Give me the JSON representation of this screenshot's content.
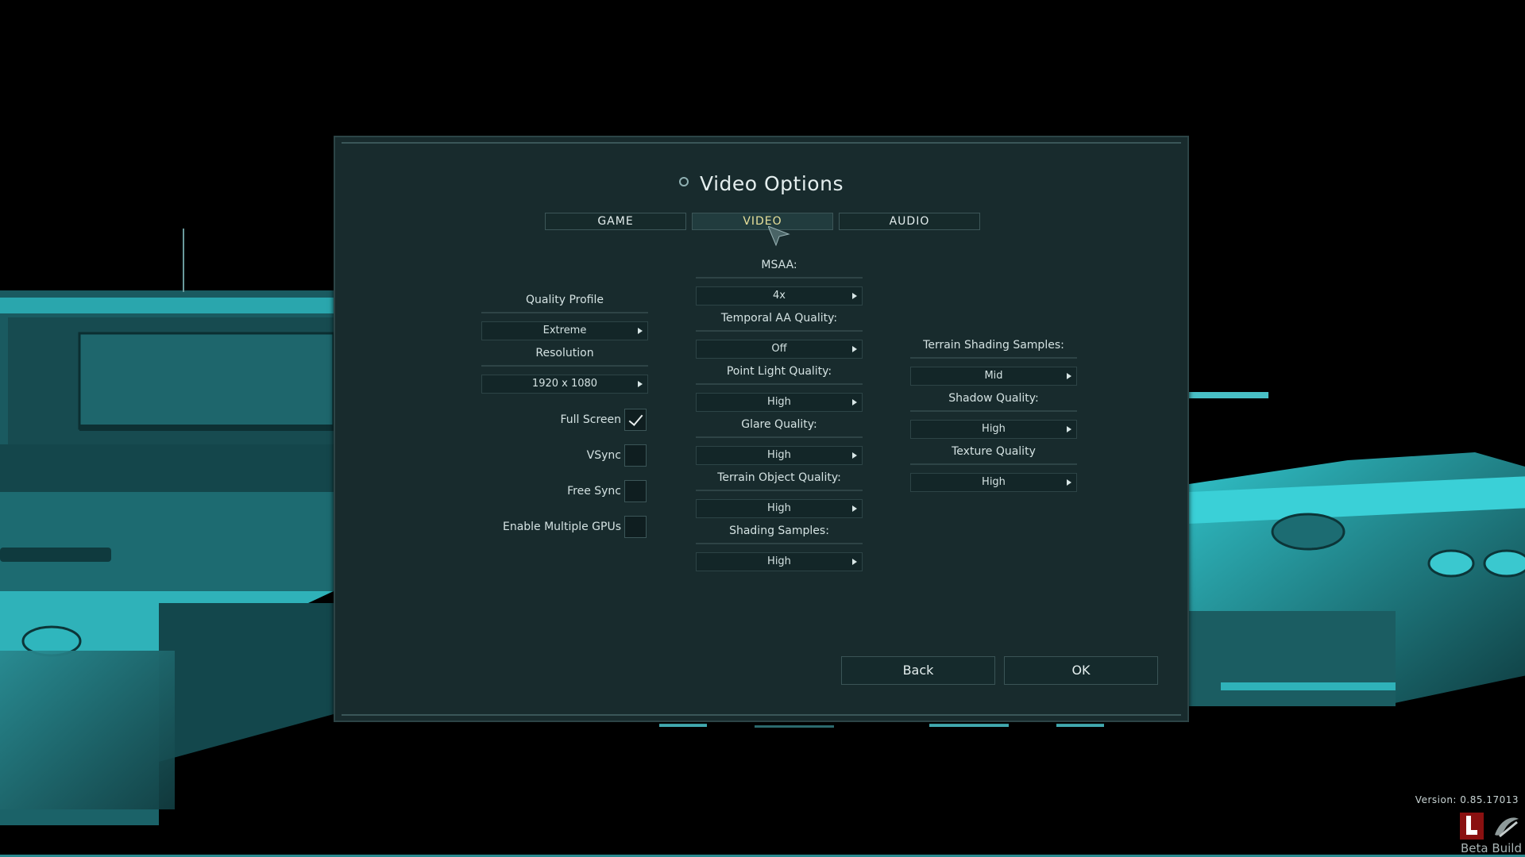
{
  "window": {
    "title": "Video Options"
  },
  "tabs": [
    {
      "label": "GAME",
      "active": false
    },
    {
      "label": "VIDEO",
      "active": true
    },
    {
      "label": "AUDIO",
      "active": false
    }
  ],
  "left": {
    "quality_profile": {
      "label": "Quality Profile",
      "value": "Extreme"
    },
    "resolution": {
      "label": "Resolution",
      "value": "1920 x 1080"
    },
    "checkboxes": [
      {
        "label": "Full Screen",
        "checked": true
      },
      {
        "label": "VSync",
        "checked": false
      },
      {
        "label": "Free Sync",
        "checked": false
      },
      {
        "label": "Enable Multiple GPUs",
        "checked": false
      }
    ]
  },
  "middle": [
    {
      "label": "MSAA:",
      "value": "4x"
    },
    {
      "label": "Temporal AA Quality:",
      "value": "Off"
    },
    {
      "label": "Point Light Quality:",
      "value": "High"
    },
    {
      "label": "Glare Quality:",
      "value": "High"
    },
    {
      "label": "Terrain Object Quality:",
      "value": "High"
    },
    {
      "label": "Shading Samples:",
      "value": "High"
    }
  ],
  "right": [
    {
      "label": "Terrain Shading Samples:",
      "value": "Mid"
    },
    {
      "label": "Shadow Quality:",
      "value": "High"
    },
    {
      "label": "Texture Quality",
      "value": "High"
    }
  ],
  "footer": {
    "back_label": "Back",
    "ok_label": "OK"
  },
  "corner": {
    "version": "Version: 0.85.17013",
    "build": "Beta Build"
  },
  "colors": {
    "accent": "#3fd6dc",
    "panel": "#1a2e30",
    "active_tab_text": "#e8e09a"
  },
  "icons": {
    "title": "gear-icon",
    "dropdown": "triangle-right-icon",
    "check": "checkmark-icon",
    "cursor": "mouse-pointer-icon"
  }
}
